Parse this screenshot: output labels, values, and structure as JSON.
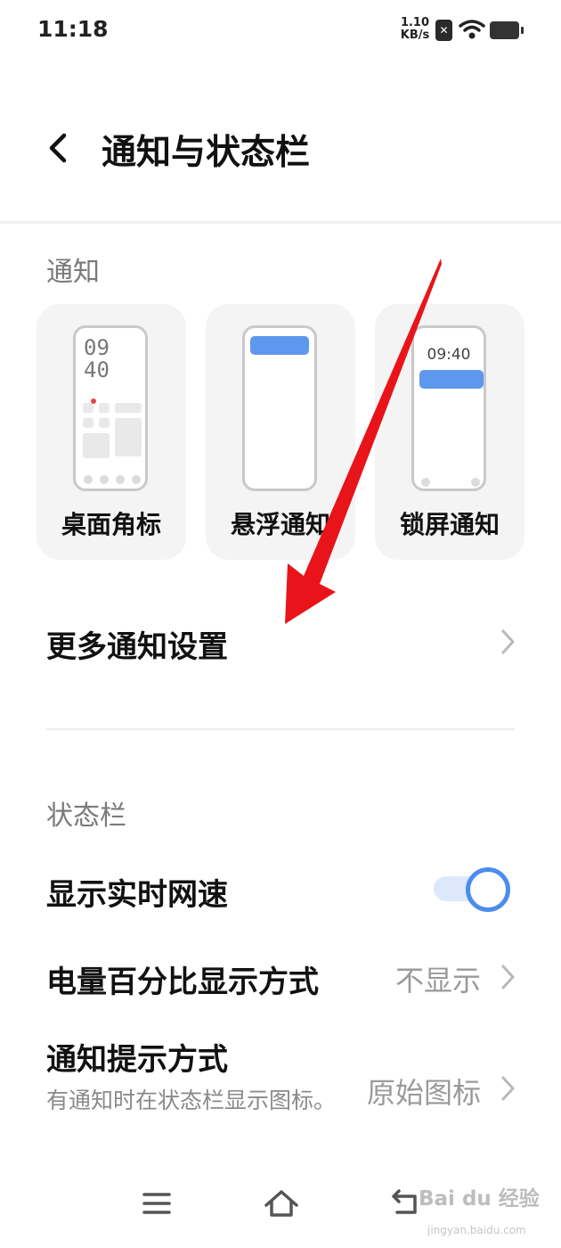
{
  "status_bar": {
    "time": "11:18",
    "net_speed_value": "1.10",
    "net_speed_unit": "KB/s",
    "sim_badge": "✕",
    "icons": [
      "sim-off-icon",
      "wifi-icon",
      "battery-icon"
    ]
  },
  "header": {
    "back_icon": "back-arrow-icon",
    "title": "通知与状态栏"
  },
  "notification_section": {
    "label": "通知",
    "cards": [
      {
        "label": "桌面角标",
        "mock_time_hh": "09",
        "mock_time_mm": "40"
      },
      {
        "label": "悬浮通知"
      },
      {
        "label": "锁屏通知",
        "mock_time": "09:40"
      }
    ],
    "more_settings_label": "更多通知设置"
  },
  "status_bar_section": {
    "label": "状态栏",
    "rows": [
      {
        "title": "显示实时网速",
        "control": "toggle",
        "toggle_on": true
      },
      {
        "title": "电量百分比显示方式",
        "value": "不显示"
      },
      {
        "title": "通知提示方式",
        "subtitle": "有通知时在状态栏显示图标。",
        "value": "原始图标"
      }
    ]
  },
  "navigation_bar": {
    "icons": [
      "menu-icon",
      "home-icon",
      "back-icon"
    ]
  },
  "watermark": {
    "brand": "Bai du 经验",
    "url": "jingyan.baidu.com"
  },
  "colors": {
    "accent": "#4c8cee",
    "banner": "#5e98ee",
    "annotation_arrow": "#e8141a",
    "card_bg": "#f4f4f4",
    "secondary_text": "#7a7a7a"
  }
}
